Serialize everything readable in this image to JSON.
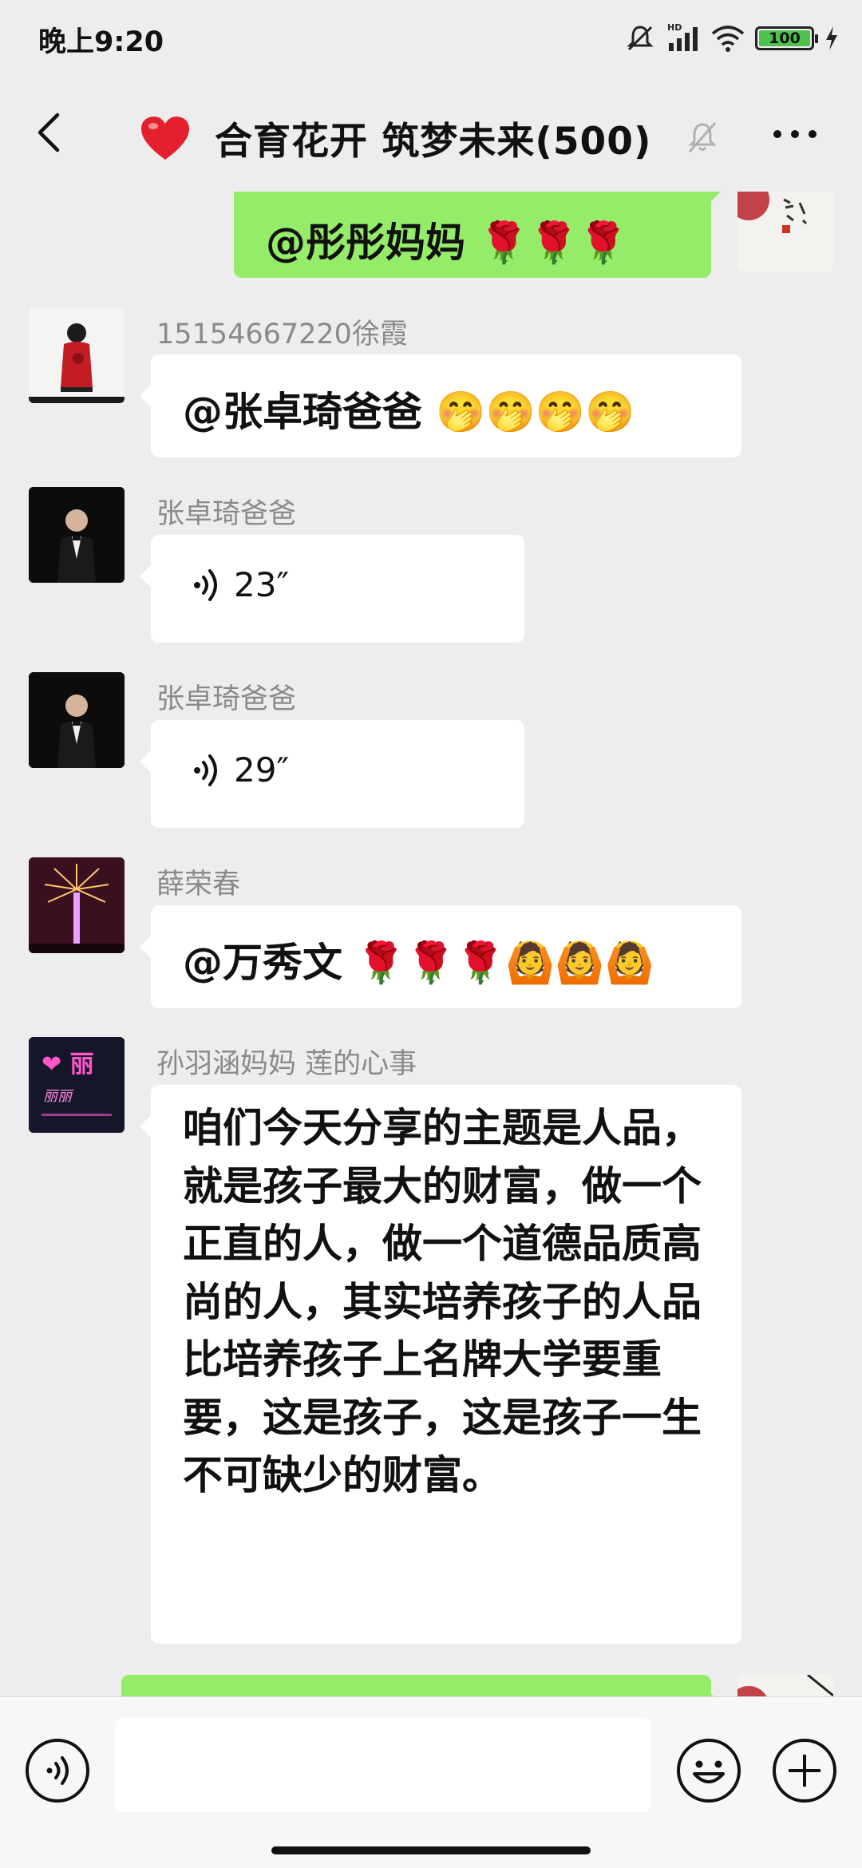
{
  "status_bar": {
    "time": "晚上9:20",
    "battery": "100"
  },
  "header": {
    "title": "合育花开 筑梦未来(500)"
  },
  "messages": [
    {
      "type": "text",
      "mine": true,
      "text": "@彤彤妈妈 🌹🌹🌹"
    },
    {
      "type": "text",
      "sender": "15154667220徐霞",
      "text": "@张卓琦爸爸 🤭🤭🤭🤭"
    },
    {
      "type": "voice",
      "sender": "张卓琦爸爸",
      "duration": "23″"
    },
    {
      "type": "voice",
      "sender": "张卓琦爸爸",
      "duration": "29″"
    },
    {
      "type": "text",
      "sender": "薛荣春",
      "text": "@万秀文 🌹🌹🌹🙆🙆🙆"
    },
    {
      "type": "text",
      "sender": "孙羽涵妈妈  莲的心事",
      "text": "咱们今天分享的主题是人品，就是孩子最大的财富，做一个正直的人，做一个道德品质高尚的人，其实培养孩子的人品比培养孩子上名牌大学要重要，这是孩子，这是孩子一生不可缺少的财富。"
    }
  ],
  "avatar_texts": {
    "neon_heart": "❤ 丽",
    "neon_script": "丽丽"
  },
  "colors": {
    "my_bubble": "#95ec69",
    "background": "#ededed",
    "bubble": "#ffffff",
    "sender_name": "#8a8a8a"
  },
  "input_bar": {
    "buttons": [
      "voice-icon",
      "emoji-icon",
      "plus-icon"
    ]
  }
}
